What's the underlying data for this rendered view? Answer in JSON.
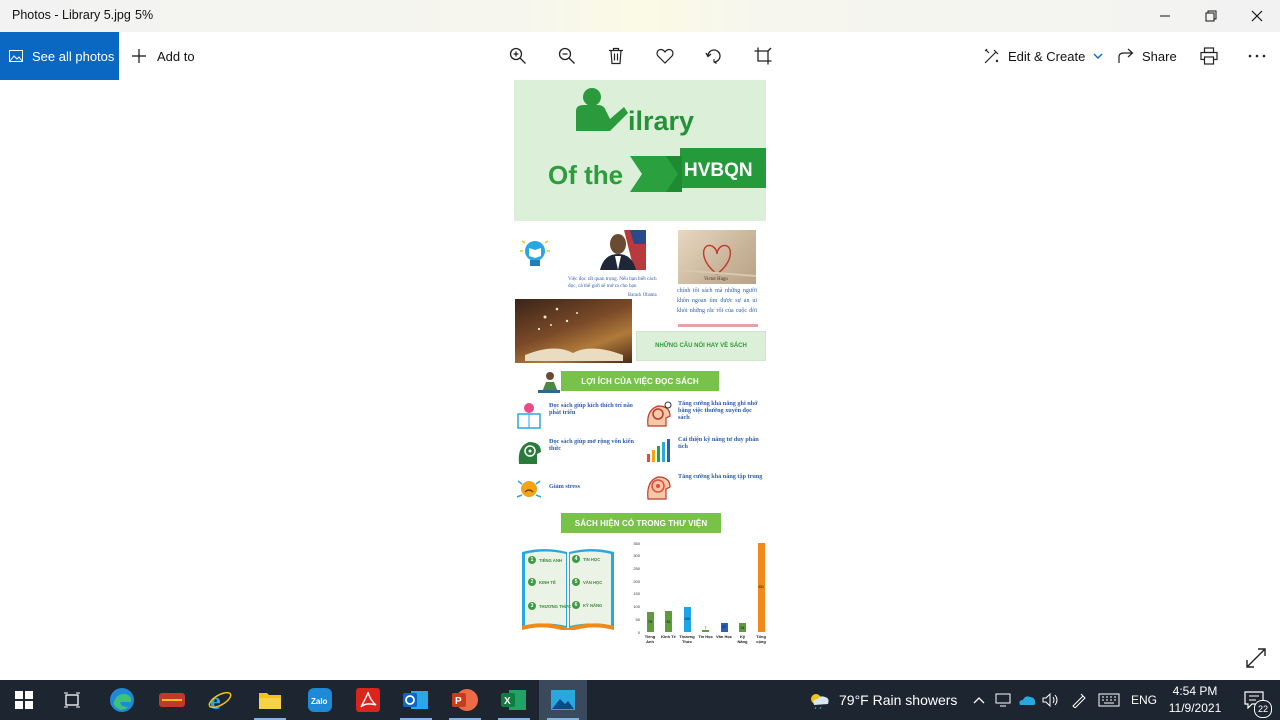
{
  "window": {
    "title": "Photos - Library 5.jpg",
    "zoom": "5%"
  },
  "toolbar": {
    "see_all": "See all photos",
    "add_to": "Add to",
    "edit_create": "Edit & Create",
    "share": "Share"
  },
  "poster": {
    "header": {
      "lib_word": "ilrary",
      "of_the": "Of the",
      "hvbqn": "HVBQN"
    },
    "quote_obama": "Việc đọc rất quan trọng. Nếu bạn biết cách đọc, cả thế giới sẽ mở ra cho bạn",
    "obama_name": "Barack Obama",
    "hugo_name": "Victor Hugo",
    "quote_hugo": "chính tôi sách mà những người khôn ngoan tìm được sự an ủi khỏi những rắc rối của cuộc đời",
    "quote_banner": "NHỮNG CÂU NÓI HAY VỀ SÁCH",
    "benefits_title": "LỢI ÍCH CỦA VIỆC ĐỌC SÁCH",
    "benefits": [
      "Đọc sách giúp kích thích trí não phát triển",
      "Tăng cường khả năng ghi nhớ bằng việc thường xuyên đọc sách",
      "Đọc sách giúp mở rộng vốn kiến thức",
      "Cải thiện kỹ năng tư duy phân tích",
      "Giảm stress",
      "Tăng cường khả năng tập trung"
    ],
    "books_title": "SÁCH HIỆN CÓ TRONG THƯ VIỆN",
    "book_items": [
      {
        "num": "1",
        "label": "TIẾNG ANH"
      },
      {
        "num": "2",
        "label": "KINH TẾ"
      },
      {
        "num": "3",
        "label": "THƯƠNG THỨC"
      },
      {
        "num": "4",
        "label": "TIN HỌC"
      },
      {
        "num": "5",
        "label": "VĂN HỌC"
      },
      {
        "num": "6",
        "label": "KỸ NĂNG"
      }
    ]
  },
  "chart_data": {
    "type": "bar",
    "categories": [
      "Tiếng Anh",
      "Kinh Tế",
      "Thương Thức",
      "Tin Học",
      "Văn Học",
      "Kỹ Năng",
      "Tổng cộng"
    ],
    "values": [
      78,
      81,
      100,
      7,
      37,
      34,
      351
    ],
    "colors": [
      "#5f9a3c",
      "#5f9a3c",
      "#1ea5e8",
      "#5f9a3c",
      "#2a5fb8",
      "#5f9a3c",
      "#f28a1a"
    ],
    "yticks": [
      "350",
      "300",
      "250",
      "200",
      "150",
      "100",
      "50",
      "0"
    ],
    "ylim": [
      0,
      350
    ]
  },
  "taskbar": {
    "weather": "79°F  Rain showers",
    "lang": "ENG",
    "time": "4:54 PM",
    "date": "11/9/2021",
    "notifications": "22"
  }
}
